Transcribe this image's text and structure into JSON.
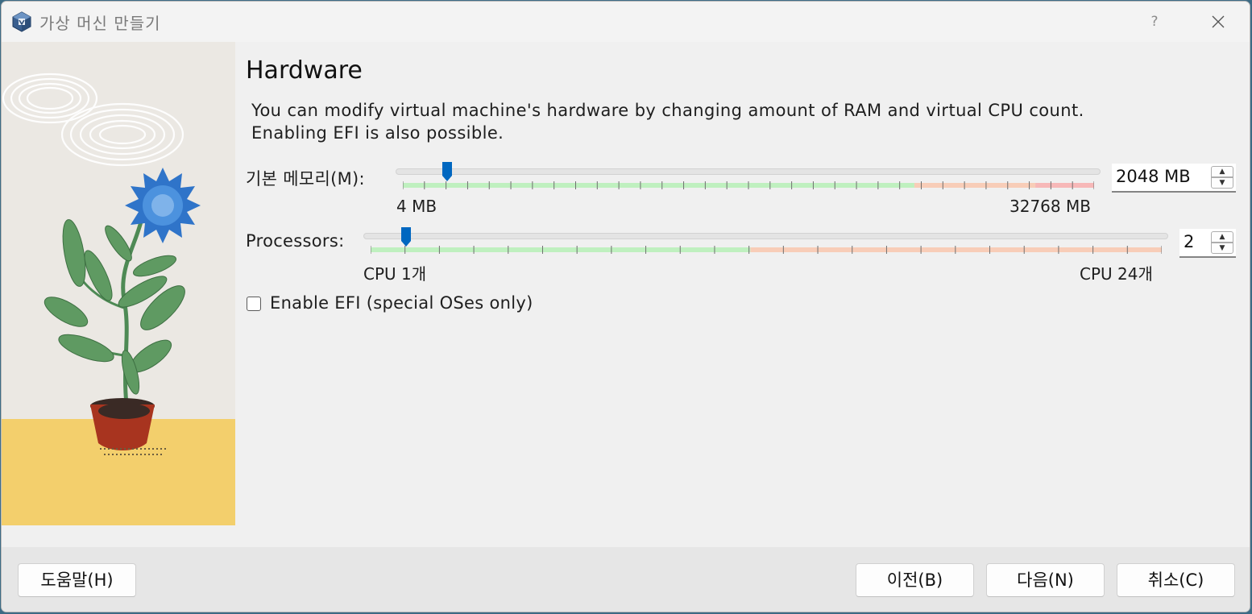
{
  "window": {
    "title": "가상 머신 만들기",
    "help_label": "?"
  },
  "page": {
    "title": "Hardware",
    "description_line1": "You can modify virtual machine's hardware by changing amount of RAM and virtual CPU count.",
    "description_line2": "Enabling EFI is also possible."
  },
  "memory": {
    "label": "기본 메모리(M):",
    "min_label": "4 MB",
    "max_label": "32768 MB",
    "value": "2048 MB",
    "value_mb": 2048,
    "min_mb": 4,
    "max_mb": 32768
  },
  "processors": {
    "label": "Processors:",
    "min_label": "CPU 1개",
    "max_label": "CPU 24개",
    "value": "2",
    "min": 1,
    "max": 24
  },
  "efi": {
    "label": "Enable EFI (special OSes only)",
    "checked": false
  },
  "buttons": {
    "help": "도움말(H)",
    "back": "이전(B)",
    "next": "다음(N)",
    "cancel": "취소(C)"
  },
  "colors": {
    "slider_green": "#bff0bf",
    "slider_orange": "#f8cdb8",
    "slider_red": "#f7b8b8",
    "handle_blue": "#0067c0"
  }
}
